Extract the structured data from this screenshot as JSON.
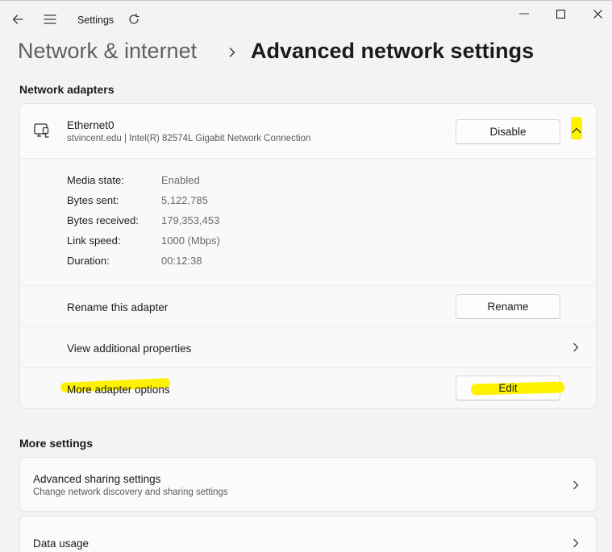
{
  "window": {
    "app_title": "Settings",
    "icons": [
      "back-arrow-icon",
      "hamburger-menu-icon",
      "refresh-icon",
      "minimize-icon",
      "maximize-icon",
      "close-icon"
    ]
  },
  "breadcrumb": {
    "parent": "Network & internet",
    "separator": "›",
    "current": "Advanced network settings"
  },
  "network_adapters": {
    "section_title": "Network adapters",
    "adapter": {
      "icon": "ethernet-icon",
      "name": "Ethernet0",
      "description": "stvincent.edu | Intel(R) 82574L Gigabit Network Connection",
      "disable_label": "Disable",
      "expanded": true,
      "details": [
        {
          "key": "Media state:",
          "value": "Enabled"
        },
        {
          "key": "Bytes sent:",
          "value": "5,122,785"
        },
        {
          "key": "Bytes received:",
          "value": "179,353,453"
        },
        {
          "key": "Link speed:",
          "value": "1000 (Mbps)"
        },
        {
          "key": "Duration:",
          "value": "00:12:38"
        }
      ],
      "rename_row": {
        "label": "Rename this adapter",
        "button": "Rename"
      },
      "properties_row": {
        "label": "View additional properties"
      },
      "options_row": {
        "label": "More adapter options",
        "button": "Edit"
      }
    }
  },
  "more_settings": {
    "section_title": "More settings",
    "items": [
      {
        "title": "Advanced sharing settings",
        "subtitle": "Change network discovery and sharing settings"
      },
      {
        "title": "Data usage"
      }
    ]
  },
  "colors": {
    "highlight": "#fff200",
    "background": "#f3f3f3",
    "card": "#fbfbfb"
  }
}
